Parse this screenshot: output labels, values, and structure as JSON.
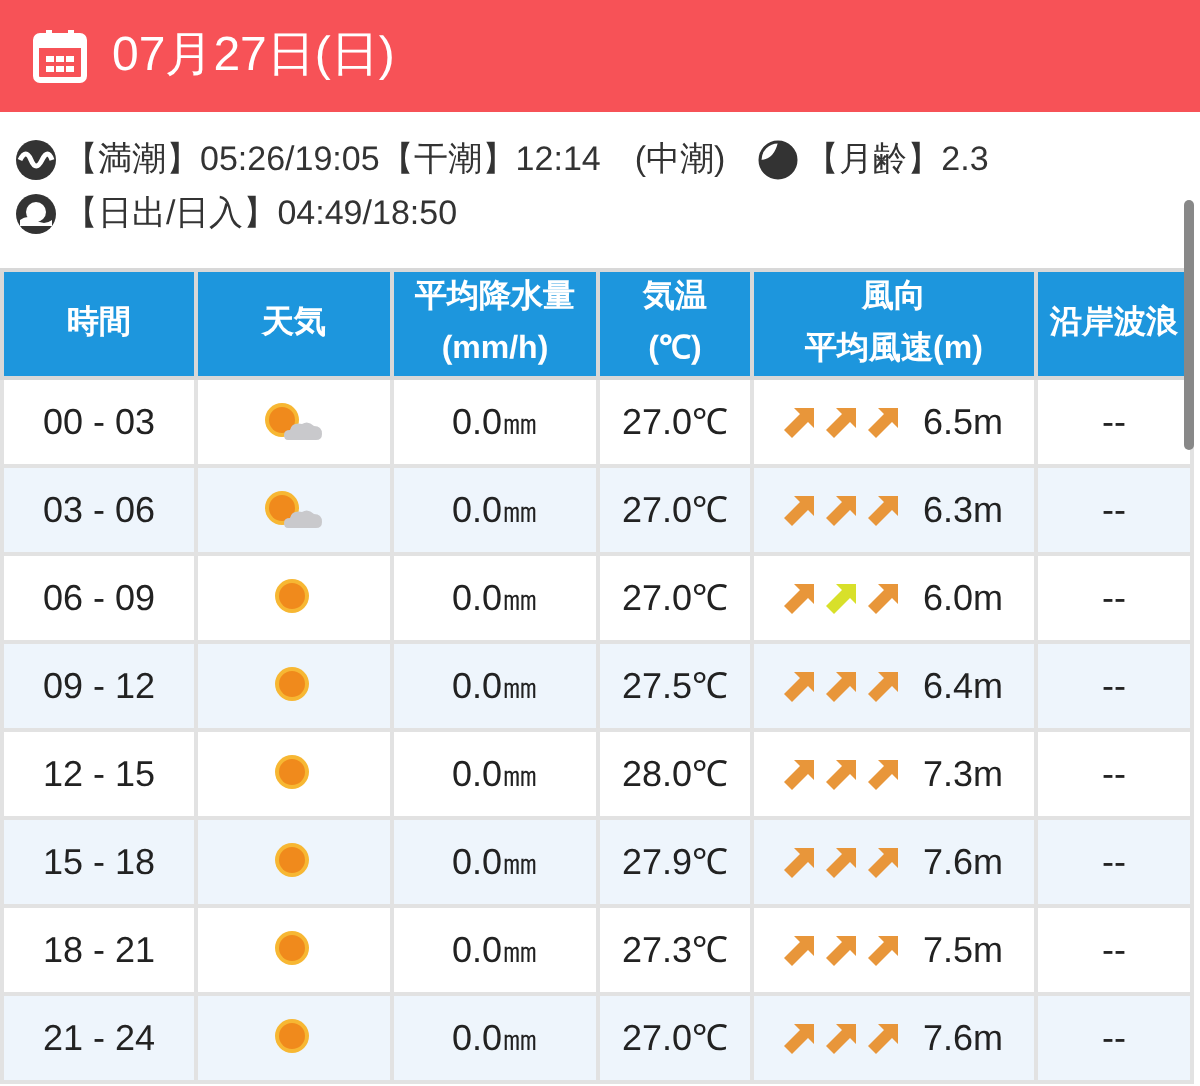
{
  "header": {
    "date": "07月27日(日)"
  },
  "info": {
    "tide": "【満潮】05:26/19:05【干潮】12:14　(中潮)",
    "moon": "【月齢】2.3",
    "sun": "【日出/日入】04:49/18:50"
  },
  "table": {
    "columns": [
      [
        "時間"
      ],
      [
        "天気"
      ],
      [
        "平均降水量",
        "(mm/h)"
      ],
      [
        "気温",
        "(℃)"
      ],
      [
        "風向",
        "平均風速(m)"
      ],
      [
        "沿岸波浪"
      ]
    ],
    "rows": [
      {
        "time": "00 - 03",
        "kind": "sun_cloud",
        "rain": "0.0㎜",
        "temp": "27.0℃",
        "arrows": [
          {
            "color": "#e8963a"
          },
          {
            "color": "#e8963a"
          },
          {
            "color": "#e8963a"
          }
        ],
        "wind": "6.5m",
        "wave": "--"
      },
      {
        "time": "03 - 06",
        "kind": "sun_cloud",
        "rain": "0.0㎜",
        "temp": "27.0℃",
        "arrows": [
          {
            "color": "#e8963a"
          },
          {
            "color": "#e8963a"
          },
          {
            "color": "#e8963a"
          }
        ],
        "wind": "6.3m",
        "wave": "--"
      },
      {
        "time": "06 - 09",
        "kind": "sun",
        "rain": "0.0㎜",
        "temp": "27.0℃",
        "arrows": [
          {
            "color": "#e8963a"
          },
          {
            "color": "#d8e02a"
          },
          {
            "color": "#e8963a"
          }
        ],
        "wind": "6.0m",
        "wave": "--"
      },
      {
        "time": "09 - 12",
        "kind": "sun",
        "rain": "0.0㎜",
        "temp": "27.5℃",
        "arrows": [
          {
            "color": "#e8963a"
          },
          {
            "color": "#e8963a"
          },
          {
            "color": "#e8963a"
          }
        ],
        "wind": "6.4m",
        "wave": "--"
      },
      {
        "time": "12 - 15",
        "kind": "sun",
        "rain": "0.0㎜",
        "temp": "28.0℃",
        "arrows": [
          {
            "color": "#e8963a"
          },
          {
            "color": "#e8963a"
          },
          {
            "color": "#e8963a"
          }
        ],
        "wind": "7.3m",
        "wave": "--"
      },
      {
        "time": "15 - 18",
        "kind": "sun",
        "rain": "0.0㎜",
        "temp": "27.9℃",
        "arrows": [
          {
            "color": "#e8963a"
          },
          {
            "color": "#e8963a"
          },
          {
            "color": "#e8963a"
          }
        ],
        "wind": "7.6m",
        "wave": "--"
      },
      {
        "time": "18 - 21",
        "kind": "sun",
        "rain": "0.0㎜",
        "temp": "27.3℃",
        "arrows": [
          {
            "color": "#e8963a"
          },
          {
            "color": "#e8963a"
          },
          {
            "color": "#e8963a"
          }
        ],
        "wind": "7.5m",
        "wave": "--"
      },
      {
        "time": "21 - 24",
        "kind": "sun",
        "rain": "0.0㎜",
        "temp": "27.0℃",
        "arrows": [
          {
            "color": "#e8963a"
          },
          {
            "color": "#e8963a"
          },
          {
            "color": "#e8963a"
          }
        ],
        "wind": "7.6m",
        "wave": "--"
      }
    ]
  }
}
